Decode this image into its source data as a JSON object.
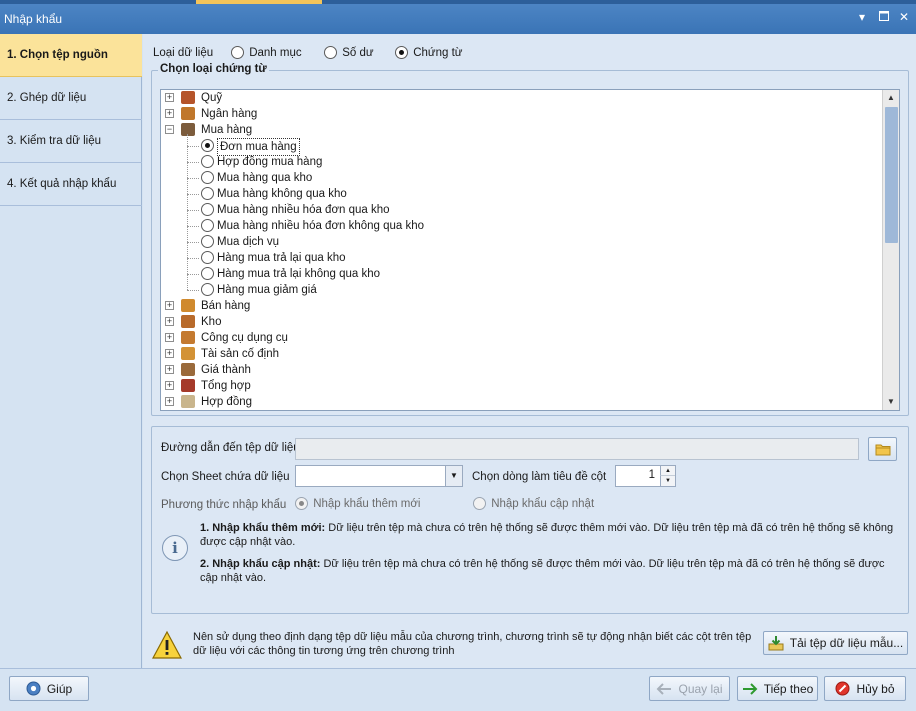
{
  "window": {
    "title": "Nhập khẩu"
  },
  "steps": [
    {
      "label": "1. Chọn tệp nguồn"
    },
    {
      "label": "2. Ghép dữ liệu"
    },
    {
      "label": "3. Kiểm tra dữ liệu"
    },
    {
      "label": "4. Kết quả nhập khẩu"
    }
  ],
  "data_type": {
    "label": "Loại dữ liệu",
    "options": [
      "Danh mục",
      "Số dư",
      "Chứng từ"
    ],
    "selected": "Chứng từ"
  },
  "voucher_group": {
    "legend": "Chọn loại chứng từ",
    "tree": {
      "top_items": [
        "Quỹ",
        "Ngân hàng",
        "Mua hàng"
      ],
      "children": [
        "Đơn mua hàng",
        "Hợp đồng mua hàng",
        "Mua hàng qua kho",
        "Mua hàng không qua kho",
        "Mua hàng nhiều hóa đơn qua kho",
        "Mua hàng nhiều hóa đơn không qua kho",
        "Mua dịch vụ",
        "Hàng mua trả lại qua kho",
        "Hàng mua trả lại không qua kho",
        "Hàng mua giảm giá"
      ],
      "selected_child": "Đơn mua hàng",
      "bottom_items": [
        "Bán hàng",
        "Kho",
        "Công cụ dụng cụ",
        "Tài sản cố định",
        "Giá thành",
        "Tổng hợp",
        "Hợp đồng"
      ],
      "icon_colors": {
        "Quỹ": "#b5542a",
        "Ngân hàng": "#c0772b",
        "Mua hàng": "#7c5c3c",
        "Bán hàng": "#d08a2e",
        "Kho": "#b86a2a",
        "Công cụ dụng cụ": "#c47a30",
        "Tài sản cố định": "#d39235",
        "Giá thành": "#9a6a3b",
        "Tổng hợp": "#a53a2a",
        "Hợp đồng": "#c9b58c"
      }
    }
  },
  "file_path": {
    "label": "Đường dẫn đến tệp dữ liệu",
    "value": ""
  },
  "sheet": {
    "label": "Chọn Sheet chứa dữ liệu",
    "value": ""
  },
  "header_row": {
    "label": "Chọn dòng làm tiêu đề cột",
    "value": "1"
  },
  "import_method": {
    "label": "Phương thức nhập khẩu",
    "options": [
      "Nhập khẩu thêm mới",
      "Nhập khẩu cập nhật"
    ],
    "selected": "Nhập khẩu thêm mới"
  },
  "notes": [
    {
      "title": "1. Nhập khẩu thêm mới:",
      "text": " Dữ liệu trên tệp mà chưa có trên hệ thống sẽ được thêm mới vào. Dữ liệu trên tệp mà đã có trên hệ thống sẽ không được cập nhật vào."
    },
    {
      "title": "2. Nhập khẩu cập nhật:",
      "text": " Dữ liệu trên tệp mà chưa có trên hệ thống sẽ được thêm mới vào. Dữ liệu trên tệp mà đã có trên hệ thống sẽ được cập nhật vào."
    }
  ],
  "warning": {
    "text": "Nên sử dụng theo định dạng tệp dữ liệu mẫu của chương trình, chương trình sẽ tự động nhận biết các cột trên tệp dữ liệu với các thông tin tương ứng trên chương trình",
    "download_label": "Tải tệp dữ liệu mẫu..."
  },
  "footer": {
    "help_label": "Giúp",
    "back_label": "Quay lại",
    "next_label": "Tiếp theo",
    "cancel_label": "Hủy bỏ"
  }
}
